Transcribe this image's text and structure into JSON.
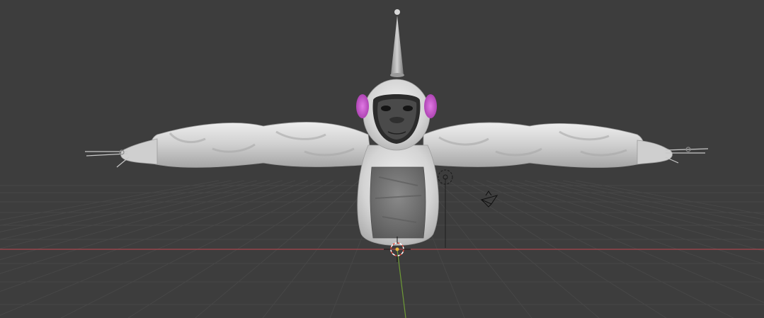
{
  "app": {
    "view": "3D Viewport",
    "shading": "material-preview"
  },
  "scene": {
    "model": "gorilla-character",
    "objects": [
      "gorilla-mesh",
      "armature",
      "light",
      "camera",
      "3d-cursor"
    ]
  },
  "colors": {
    "background": "#3d3d3d",
    "grid_line": "#4a4a4a",
    "x_axis": "#a8464e",
    "y_axis": "#6e9a36",
    "fur": "#d6d6d6",
    "chest": "#767676",
    "face": "#2b2b2b",
    "ears": "#c455c8",
    "cone": "#b4b4b4"
  },
  "icons": {
    "cursor": "3d-cursor-icon",
    "light": "point-light-icon",
    "camera": "camera-icon"
  }
}
